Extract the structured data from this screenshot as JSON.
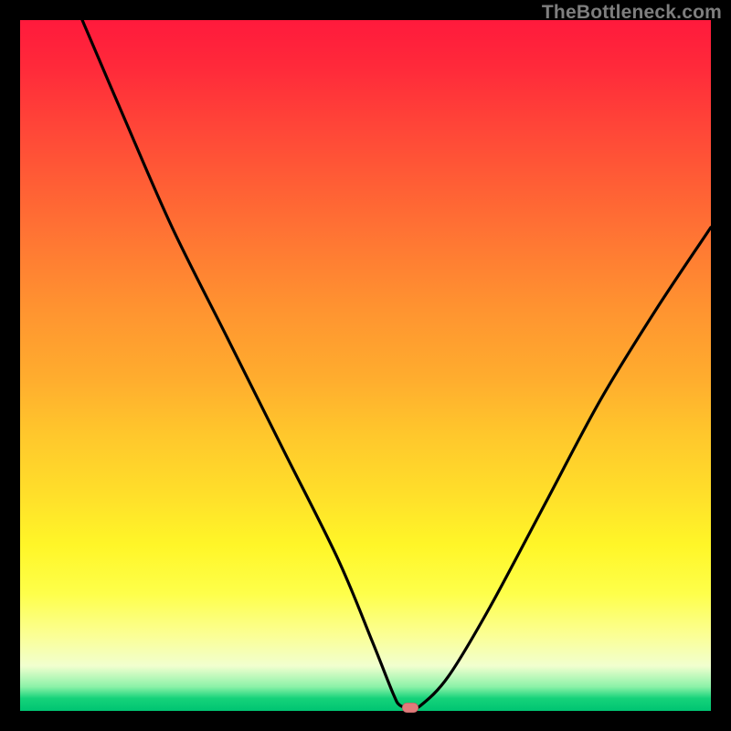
{
  "watermark": "TheBottleneck.com",
  "marker": {
    "color": "#e07a7a",
    "cx_ratio": 0.565,
    "cy_ratio": 0.992
  },
  "chart_data": {
    "type": "line",
    "title": "",
    "xlabel": "",
    "ylabel": "",
    "xlim": [
      0,
      100
    ],
    "ylim": [
      0,
      100
    ],
    "grid": false,
    "background": "gradient-red-yellow-green",
    "series": [
      {
        "name": "bottleneck-curve",
        "x": [
          9,
          15,
          22,
          30,
          38,
          46,
          51,
          54,
          55,
          56.5,
          58,
          62,
          68,
          76,
          84,
          92,
          100
        ],
        "y": [
          100,
          86,
          70,
          54,
          38,
          22,
          10,
          2.5,
          0.8,
          0.5,
          0.8,
          5,
          15,
          30,
          45,
          58,
          70
        ]
      }
    ],
    "marker_point": {
      "x": 56.5,
      "y": 0.5
    },
    "watermark": "TheBottleneck.com"
  }
}
